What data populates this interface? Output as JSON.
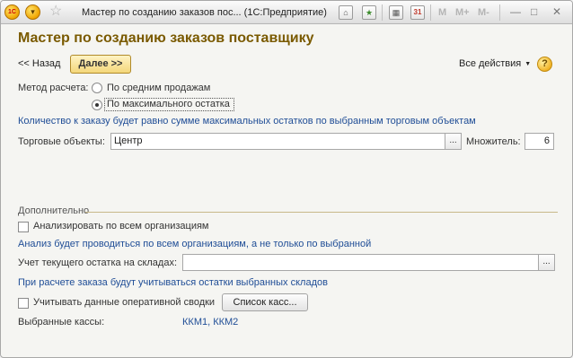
{
  "titlebar": {
    "logo_text": "1C",
    "title": "Мастер по созданию заказов пос...  (1С:Предприятие)",
    "icons": [
      "logo-icon",
      "menu-arrow-icon",
      "star-icon",
      "home-icon",
      "bookmark-icon",
      "calculator-icon",
      "calendar-icon"
    ],
    "mem_buttons": [
      "M",
      "M+",
      "M-"
    ],
    "calendar_day": "31"
  },
  "form": {
    "title": "Мастер по созданию заказов поставщику",
    "toolbar": {
      "back_label": "<< Назад",
      "next_label": "Далее >>",
      "all_actions_label": "Все действия",
      "help_label": "?"
    },
    "calc_method": {
      "label": "Метод расчета:",
      "options": [
        "По средним продажам",
        "По максимального остатка"
      ],
      "selected_index": 1
    },
    "method_hint": "Количество к заказу будет равно сумме максимальных остатков по выбранным торговым объектам",
    "trade_objects": {
      "label": "Торговые объекты:",
      "value": "Центр",
      "select_button": "..."
    },
    "multiplier": {
      "label": "Множитель:",
      "value": "6"
    },
    "additional": {
      "title": "Дополнительно",
      "analyze_all_orgs": {
        "label": "Анализировать по всем организациям",
        "checked": false,
        "hint": "Анализ будет проводиться по всем организациям, а не только по выбранной"
      },
      "stock_warehouses": {
        "label": "Учет текущего остатка на складах:",
        "value": "",
        "select_button": "...",
        "hint": "При расчете заказа будут учитываться остатки выбранных складов"
      },
      "operative_summary": {
        "label": "Учитывать данные оперативной сводки",
        "checked": false,
        "button_label": "Список касс..."
      },
      "selected_registers": {
        "label": "Выбранные кассы:",
        "value": "ККМ1, ККМ2"
      }
    }
  },
  "colors": {
    "title": "#7a5a00",
    "hint": "#1f4d96",
    "next_button": "#f4d77a",
    "group_line": "#c8b98a"
  }
}
